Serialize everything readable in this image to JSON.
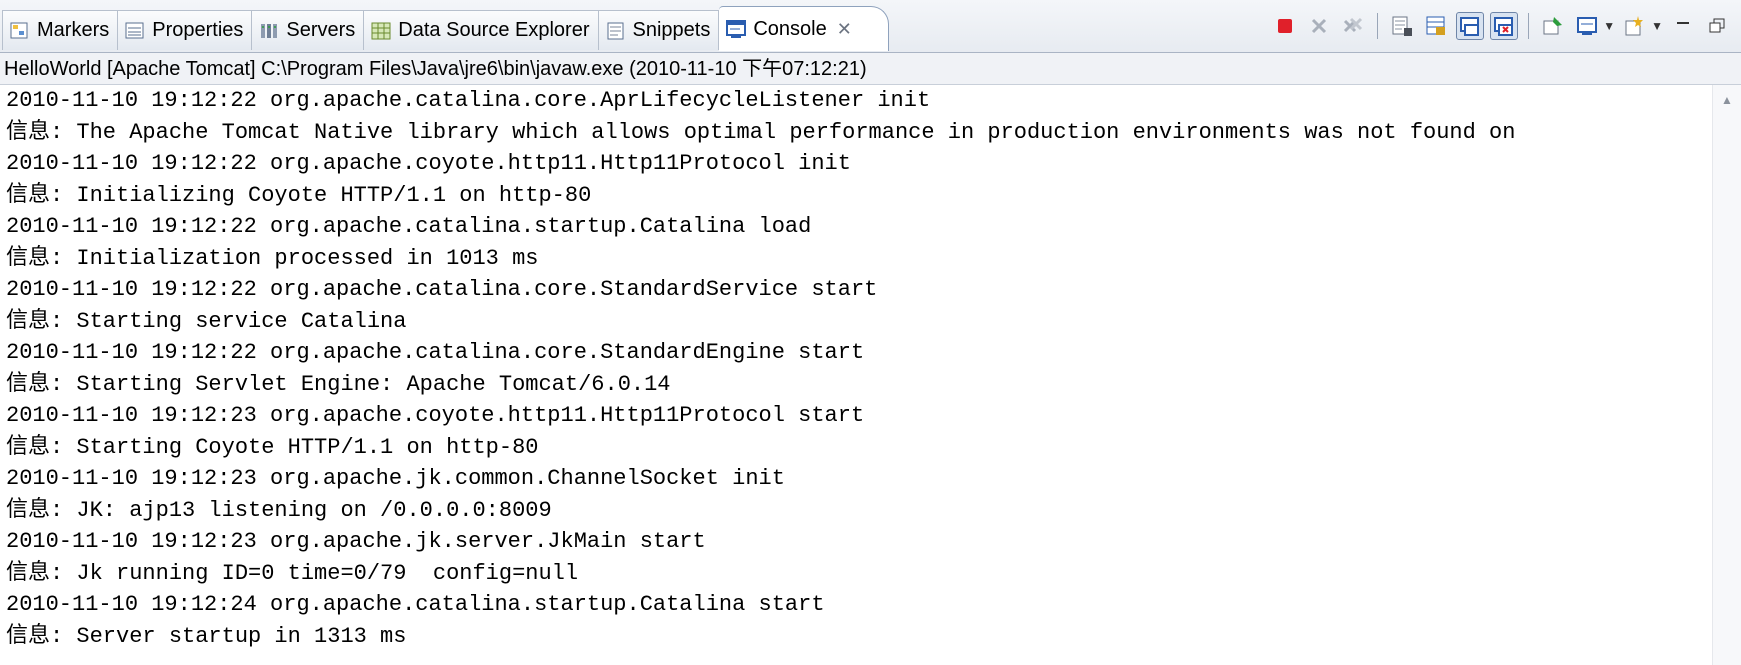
{
  "tabs": [
    {
      "label": "Markers",
      "icon": "markers-icon",
      "active": false
    },
    {
      "label": "Properties",
      "icon": "properties-icon",
      "active": false
    },
    {
      "label": "Servers",
      "icon": "servers-icon",
      "active": false
    },
    {
      "label": "Data Source Explorer",
      "icon": "data-source-explorer-icon",
      "active": false
    },
    {
      "label": "Snippets",
      "icon": "snippets-icon",
      "active": false
    },
    {
      "label": "Console",
      "icon": "console-icon",
      "active": true,
      "close": "✕"
    }
  ],
  "toolbar": {
    "buttons": [
      "terminate-icon",
      "remove-launch-icon",
      "remove-all-terminated-icon",
      "clear-console-icon",
      "scroll-lock-icon",
      "show-on-stdout-icon",
      "show-on-stderr-icon",
      "pin-console-icon",
      "display-selected-console-icon",
      "open-console-icon"
    ],
    "colors": {
      "terminate": "#e0202a",
      "accent": "#2a5db0"
    }
  },
  "header": {
    "text": "HelloWorld [Apache Tomcat] C:\\Program Files\\Java\\jre6\\bin\\javaw.exe (2010-11-10 下午07:12:21)"
  },
  "console": {
    "lines": [
      "2010-11-10 19:12:22 org.apache.catalina.core.AprLifecycleListener init",
      "信息: The Apache Tomcat Native library which allows optimal performance in production environments was not found on",
      "2010-11-10 19:12:22 org.apache.coyote.http11.Http11Protocol init",
      "信息: Initializing Coyote HTTP/1.1 on http-80",
      "2010-11-10 19:12:22 org.apache.catalina.startup.Catalina load",
      "信息: Initialization processed in 1013 ms",
      "2010-11-10 19:12:22 org.apache.catalina.core.StandardService start",
      "信息: Starting service Catalina",
      "2010-11-10 19:12:22 org.apache.catalina.core.StandardEngine start",
      "信息: Starting Servlet Engine: Apache Tomcat/6.0.14",
      "2010-11-10 19:12:23 org.apache.coyote.http11.Http11Protocol start",
      "信息: Starting Coyote HTTP/1.1 on http-80",
      "2010-11-10 19:12:23 org.apache.jk.common.ChannelSocket init",
      "信息: JK: ajp13 listening on /0.0.0.0:8009",
      "2010-11-10 19:12:23 org.apache.jk.server.JkMain start",
      "信息: Jk running ID=0 time=0/79  config=null",
      "2010-11-10 19:12:24 org.apache.catalina.startup.Catalina start",
      "信息: Server startup in 1313 ms"
    ]
  }
}
